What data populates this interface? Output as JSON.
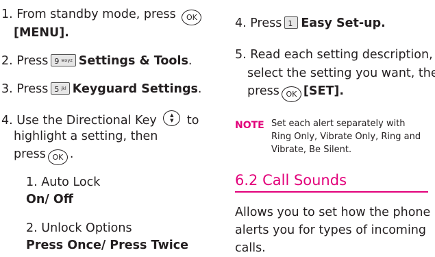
{
  "left": {
    "step1": {
      "text": "1. From standby mode, press",
      "key": "OK",
      "menu": "[MENU]."
    },
    "step2": {
      "text": "2. Press",
      "key_num": "9",
      "key_sub": "wxyz",
      "label": "Settings & Tools",
      "end": "."
    },
    "step3": {
      "text": "3. Press",
      "key_num": "5",
      "key_sub": "jkl",
      "label": "Keyguard Settings",
      "end": "."
    },
    "step4": {
      "line1": "4. Use the Directional Key",
      "line1_end": "to",
      "line2": "highlight a setting, then",
      "line3": "press",
      "key": "OK",
      "line3_end": "."
    },
    "sub1": {
      "title": "1. Auto Lock",
      "value": "On/ Off"
    },
    "sub2": {
      "title": "2. Unlock Options",
      "value": "Press Once/ Press Twice"
    }
  },
  "right": {
    "step4": {
      "text": "4. Press",
      "key_num": "1",
      "key_sub": "",
      "label": "Easy Set-up."
    },
    "step5": {
      "line1": "5. Read each setting description,",
      "line2": "select the setting you want, then",
      "line3": "press",
      "key": "OK",
      "set": "[SET]."
    },
    "note": {
      "label": "NOTE",
      "line1": "Set each alert separately with",
      "line2": "Ring Only, Vibrate Only, Ring and",
      "line3": "Vibrate, Be Silent."
    },
    "section": {
      "heading": "6.2 Call Sounds",
      "line1": "Allows you to set how the phone",
      "line2": "alerts you for types of incoming",
      "line3": "calls."
    }
  },
  "colors": {
    "accent": "#e2007a",
    "text": "#231f20"
  }
}
